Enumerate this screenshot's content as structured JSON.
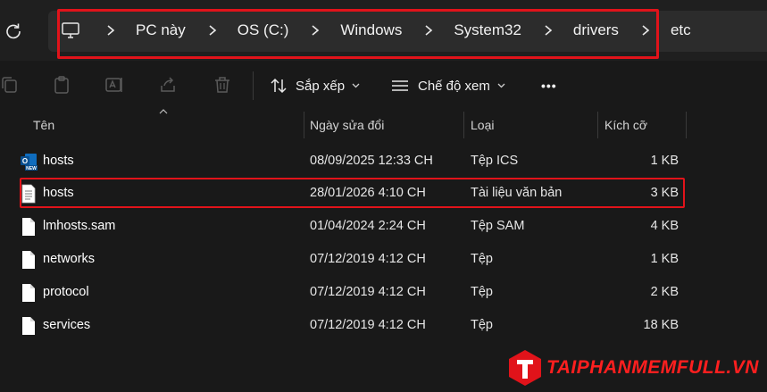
{
  "address_bar": {
    "breadcrumbs": [
      "PC này",
      "OS (C:)",
      "Windows",
      "System32",
      "drivers",
      "etc"
    ]
  },
  "toolbar": {
    "sort_label": "Sắp xếp",
    "view_label": "Chế độ xem",
    "more_label": "•••"
  },
  "columns": {
    "name": "Tên",
    "date": "Ngày sửa đổi",
    "type": "Loại",
    "size": "Kích cỡ"
  },
  "files": [
    {
      "name": "hosts",
      "date": "08/09/2025 12:33 CH",
      "type": "Tệp ICS",
      "size": "1 KB",
      "icon": "outlook-calendar-icon"
    },
    {
      "name": "hosts",
      "date": "28/01/2026 4:10 CH",
      "type": "Tài liệu văn bản",
      "size": "3 KB",
      "icon": "text-document-icon"
    },
    {
      "name": "lmhosts.sam",
      "date": "01/04/2024 2:24 CH",
      "type": "Tệp SAM",
      "size": "4 KB",
      "icon": "file-icon"
    },
    {
      "name": "networks",
      "date": "07/12/2019 4:12 CH",
      "type": "Tệp",
      "size": "1 KB",
      "icon": "file-icon"
    },
    {
      "name": "protocol",
      "date": "07/12/2019 4:12 CH",
      "type": "Tệp",
      "size": "2 KB",
      "icon": "file-icon"
    },
    {
      "name": "services",
      "date": "07/12/2019 4:12 CH",
      "type": "Tệp",
      "size": "18 KB",
      "icon": "file-icon"
    }
  ],
  "watermark": {
    "text": "TAIPHANMEMFULL.VN"
  },
  "colors": {
    "background": "#191919",
    "address_bar": "#2c2c2c",
    "highlight": "#e1131a",
    "text": "#ffffff"
  }
}
